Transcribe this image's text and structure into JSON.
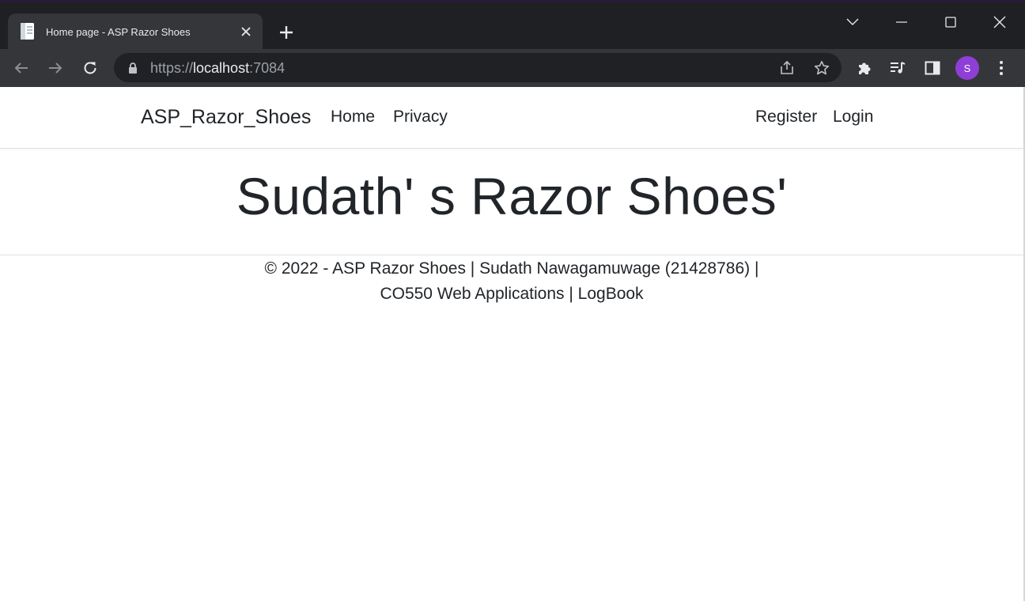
{
  "browser": {
    "tab": {
      "title": "Home page - ASP Razor Shoes"
    },
    "url": {
      "scheme": "https://",
      "host": "localhost",
      "port": ":7084"
    },
    "profile_initial": "S"
  },
  "navbar": {
    "brand": "ASP_Razor_Shoes",
    "links": [
      "Home",
      "Privacy"
    ],
    "auth": [
      "Register",
      "Login"
    ]
  },
  "main": {
    "heading": "Sudath' s Razor Shoes'"
  },
  "footer": {
    "line1": "© 2022 - ASP Razor Shoes | Sudath Nawagamuwage (21428786) |",
    "line2_prefix": "CO550 Web Applications | ",
    "logbook": "LogBook"
  }
}
